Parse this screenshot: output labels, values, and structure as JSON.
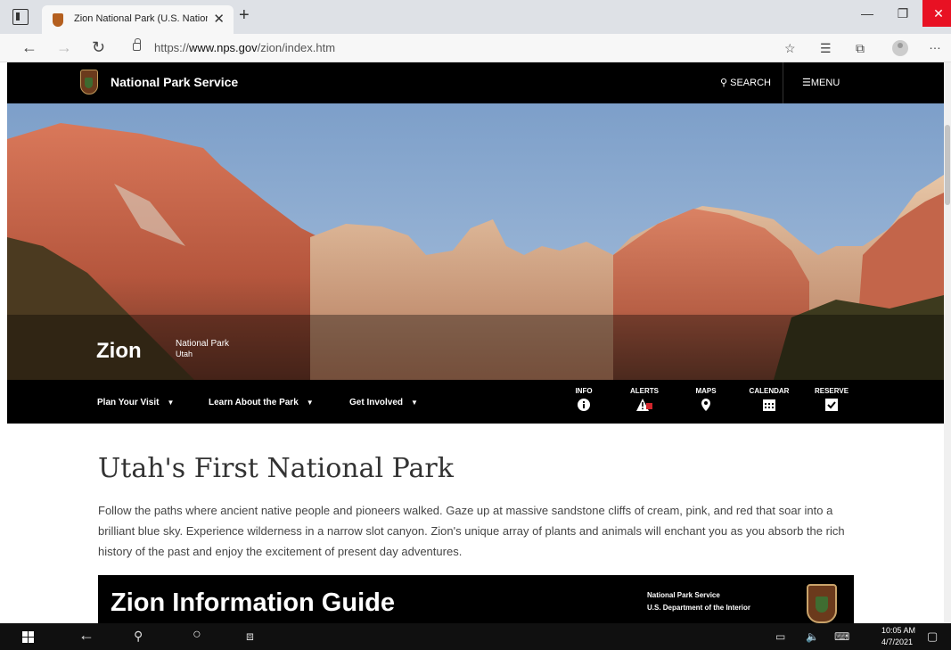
{
  "browser": {
    "tab_title": "Zion National Park (U.S. Nationa",
    "url_prefix": "https://",
    "url_host": "www.nps.gov",
    "url_path": "/zion/index.htm"
  },
  "site_header": {
    "org_name": "National Park Service",
    "search_label": "SEARCH",
    "menu_label": "MENU"
  },
  "hero": {
    "park_name": "Zion",
    "designation": "National Park",
    "state": "Utah"
  },
  "park_nav": {
    "items": [
      {
        "label": "Plan Your Visit"
      },
      {
        "label": "Learn About the Park"
      },
      {
        "label": "Get Involved"
      }
    ],
    "quick_links": [
      {
        "label": "INFO",
        "icon": "info-icon"
      },
      {
        "label": "ALERTS",
        "icon": "alert-icon"
      },
      {
        "label": "MAPS",
        "icon": "map-pin-icon"
      },
      {
        "label": "CALENDAR",
        "icon": "calendar-icon"
      },
      {
        "label": "RESERVE",
        "icon": "checkbox-icon"
      }
    ]
  },
  "main": {
    "title": "Utah's First National Park",
    "intro": "Follow the paths where ancient native people and pioneers walked. Gaze up at massive sandstone cliffs of cream, pink, and red that soar into a brilliant blue sky. Experience wilderness in a narrow slot canyon. Zion's unique array of plants and animals will enchant you as you absorb the rich history of the past and enjoy the excitement of present day adventures."
  },
  "guide_banner": {
    "title": "Zion Information Guide",
    "agency": "National Park Service",
    "department": "U.S. Department of the Interior"
  },
  "taskbar": {
    "time": "10:05 AM",
    "date": "4/7/2021"
  },
  "colors": {
    "header_bg": "#000000",
    "window_close": "#e81123",
    "taskbar_bg": "#101010"
  }
}
